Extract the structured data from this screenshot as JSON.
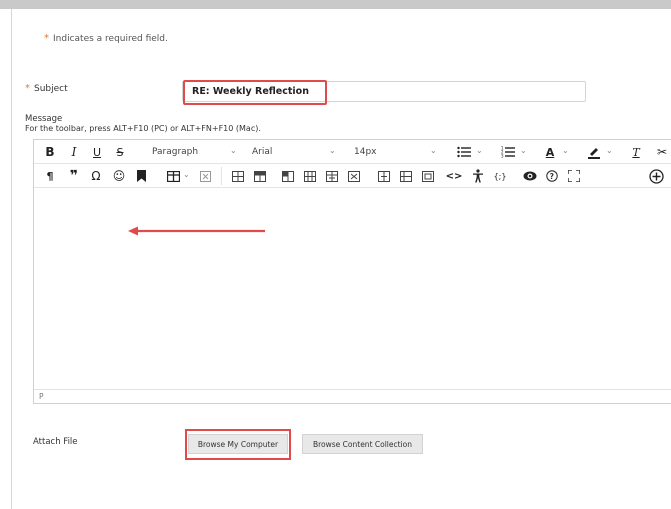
{
  "form": {
    "required_note": "Indicates a required field.",
    "required_marker": "*",
    "subject_label": "Subject",
    "subject_value": "RE: Weekly Reflection",
    "message_label": "Message",
    "toolbar_hint": "For the toolbar, press ALT+F10 (PC) or ALT+FN+F10 (Mac).",
    "attach_label": "Attach File",
    "browse_computer": "Browse My Computer",
    "browse_content": "Browse Content Collection"
  },
  "editor": {
    "format_block": "Paragraph",
    "font_family": "Arial",
    "font_size": "14px",
    "status_path": "P",
    "toolbar1_icons": [
      "bold-icon",
      "italic-icon",
      "underline-icon",
      "strikethrough-icon",
      "bullet-list-icon",
      "numbered-list-icon",
      "text-color-icon",
      "highlight-color-icon",
      "clear-format-icon",
      "cut-icon"
    ],
    "toolbar2_icons": [
      "paragraph-mark-icon",
      "blockquote-icon",
      "special-char-icon",
      "emoji-icon",
      "bookmark-icon",
      "table-icon",
      "delete-table-icon",
      "insert-row-before-icon",
      "insert-row-after-icon",
      "delete-row-icon",
      "insert-col-before-icon",
      "insert-col-after-icon",
      "delete-col-icon",
      "split-cell-icon",
      "merge-cell-icon",
      "cell-props-icon",
      "code-icon",
      "accessibility-icon",
      "source-code-icon",
      "preview-icon",
      "help-icon",
      "fullscreen-icon",
      "add-content-icon"
    ]
  },
  "colors": {
    "required_star": "#e07a2e",
    "highlight_box": "#e04a4a",
    "annotation_arrow": "#e04a4a"
  }
}
